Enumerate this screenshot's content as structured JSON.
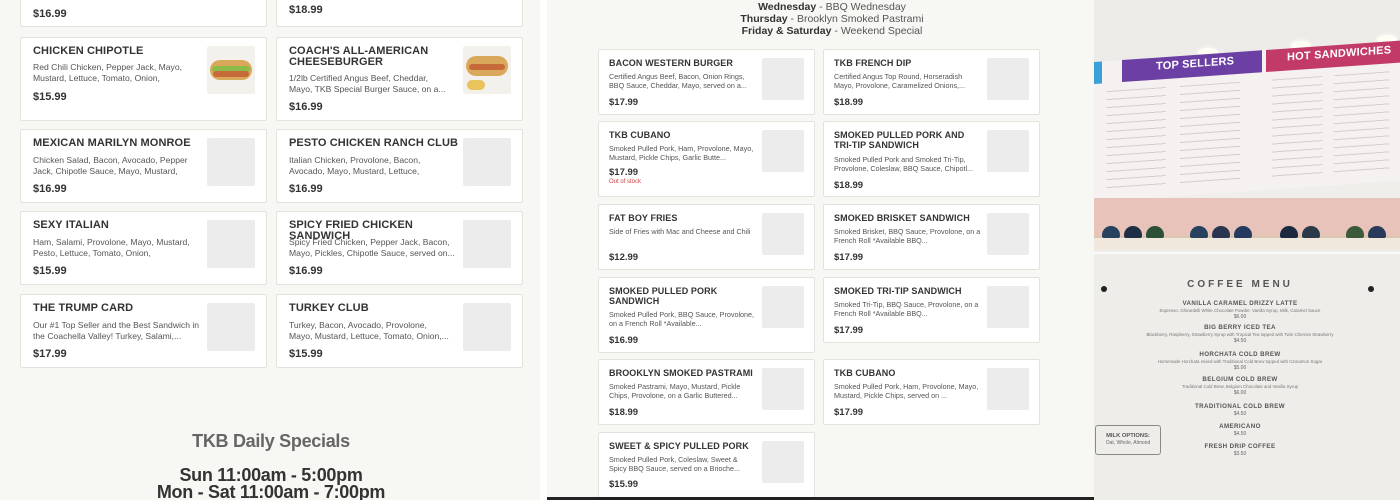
{
  "left_menu": {
    "top_prices": [
      "$16.99",
      "$18.99"
    ],
    "items": [
      {
        "name": "CHICKEN CHIPOTLE",
        "desc": "Red Chili Chicken, Pepper Jack, Mayo, Mustard, Lettuce, Tomato, Onion,",
        "price": "$15.99"
      },
      {
        "name": "COACH'S ALL-AMERICAN CHEESEBURGER",
        "desc": "1/2lb Certified Angus Beef, Cheddar, Mayo, TKB Special Burger Sauce, on a...",
        "price": "$16.99"
      },
      {
        "name": "MEXICAN MARILYN MONROE",
        "desc": "Chicken Salad, Bacon, Avocado, Pepper Jack, Chipotle Sauce, Mayo, Mustard,",
        "price": "$16.99"
      },
      {
        "name": "PESTO CHICKEN RANCH CLUB",
        "desc": "Italian Chicken, Provolone, Bacon, Avocado, Mayo, Mustard, Lettuce,",
        "price": "$16.99"
      },
      {
        "name": "SEXY ITALIAN",
        "desc": "Ham, Salami, Provolone, Mayo, Mustard, Pesto, Lettuce, Tomato, Onion,",
        "price": "$15.99"
      },
      {
        "name": "SPICY FRIED CHICKEN SANDWICH",
        "desc": "Spicy Fried Chicken, Pepper Jack, Bacon, Mayo, Pickles, Chipotle Sauce, served on...",
        "price": "$16.99"
      },
      {
        "name": "THE TRUMP CARD",
        "desc": "Our #1 Top Seller and the Best Sandwich in the Coachella Valley! Turkey, Salami,...",
        "price": "$17.99"
      },
      {
        "name": "TURKEY CLUB",
        "desc": "Turkey, Bacon, Avocado, Provolone, Mayo, Mustard, Lettuce, Tomato, Onion,...",
        "price": "$15.99"
      }
    ],
    "specials_title": "TKB Daily Specials",
    "hours": [
      "Sun 11:00am - 5:00pm",
      "Mon - Sat 11:00am - 7:00pm"
    ]
  },
  "mid_menu": {
    "days": [
      {
        "day": "Wednesday",
        "special": " - BBQ Wednesday"
      },
      {
        "day": "Thursday",
        "special": " - Brooklyn Smoked Pastrami"
      },
      {
        "day": "Friday & Saturday",
        "special": " - Weekend Special"
      }
    ],
    "items": [
      {
        "name": "BACON WESTERN BURGER",
        "desc": "Certified Angus Beef, Bacon, Onion Rings, BBQ Sauce, Cheddar, Mayo, served on a...",
        "price": "$17.99"
      },
      {
        "name": "TKB FRENCH DIP",
        "desc": "Certified Angus Top Round, Horseradish Mayo, Provolone, Caramelized Onions,...",
        "price": "$18.99"
      },
      {
        "name": "TKB CUBANO",
        "desc": "Smoked Pulled Pork, Ham, Provolone, Mayo, Mustard, Pickle Chips, Garlic Butte...",
        "price": "$17.99",
        "status": "Out of stock"
      },
      {
        "name": "SMOKED PULLED PORK AND TRI-TIP SANDWICH",
        "desc": "Smoked Pulled Pork and Smoked Tri-Tip, Provolone, Coleslaw, BBQ Sauce, Chipotl...",
        "price": "$18.99"
      },
      {
        "name": "FAT BOY FRIES",
        "desc": "Side of Fries with Mac and Cheese and Chili",
        "price": "$12.99"
      },
      {
        "name": "SMOKED BRISKET SANDWICH",
        "desc": "Smoked Brisket, BBQ Sauce, Provolone, on a French Roll *Available BBQ...",
        "price": "$17.99"
      },
      {
        "name": "SMOKED PULLED PORK SANDWICH",
        "desc": "Smoked Pulled Pork, BBQ Sauce, Provolone, on a French Roll *Available...",
        "price": "$16.99"
      },
      {
        "name": "SMOKED TRI-TIP SANDWICH",
        "desc": "Smoked Tri-Tip, BBQ Sauce, Provolone, on a French Roll *Available BBQ...",
        "price": "$17.99"
      },
      {
        "name": "BROOKLYN SMOKED PASTRAMI",
        "desc": "Smoked Pastrami, Mayo, Mustard, Pickle Chips, Provolone, on a Garlic Buttered...",
        "price": "$18.99"
      },
      {
        "name": "TKB CUBANO",
        "desc": "Smoked Pulled Pork, Ham, Provolone, Mayo, Mustard, Pickle Chips, served on ...",
        "price": "$17.99"
      },
      {
        "name": "SWEET & SPICY PULLED PORK",
        "desc": "Smoked Pulled Pork, Coleslaw, Sweet & Spicy BBQ Sauce, served on a Brioche...",
        "price": "$15.99"
      }
    ]
  },
  "photo": {
    "board_titles": [
      "TOP SELLERS",
      "HOT SANDWICHES"
    ],
    "coffee_title": "COFFEE MENU",
    "coffee_items": [
      {
        "name": "VANILLA CARAMEL DRIZZY LATTE",
        "desc": "Espresso, Ghirardelli White Chocolate Powder, Vanilla Syrup, Milk, Caramel Sauce",
        "price": "$6.00"
      },
      {
        "name": "BIG BERRY ICED TEA",
        "desc": "Blackberry, Raspberry, Strawberry Syrup with Tropical Tea topped with Twin Cherries Strawberry",
        "price": "$4.50"
      },
      {
        "name": "HORCHATA COLD BREW",
        "desc": "Homemade Horchata mixed with Traditional Cold Brew topped with Cinnamon Sugar",
        "price": "$5.00"
      },
      {
        "name": "BELGIUM COLD BREW",
        "desc": "Traditional Cold Brew, Belgium Chocolate and Vanilla Syrup",
        "price": "$6.00"
      },
      {
        "name": "TRADITIONAL COLD BREW",
        "desc": "",
        "price": "$4.50"
      },
      {
        "name": "AMERICANO",
        "desc": "",
        "price": "$4.50"
      },
      {
        "name": "FRESH DRIP COFFEE",
        "desc": "",
        "price": "$3.50"
      }
    ],
    "milk_title": "MILK OPTIONS:",
    "milk_options": "Oat, Whole, Almond",
    "colors": {
      "top_sellers": "#6b3fa3",
      "hot_sandwiches": "#c23a68"
    }
  }
}
